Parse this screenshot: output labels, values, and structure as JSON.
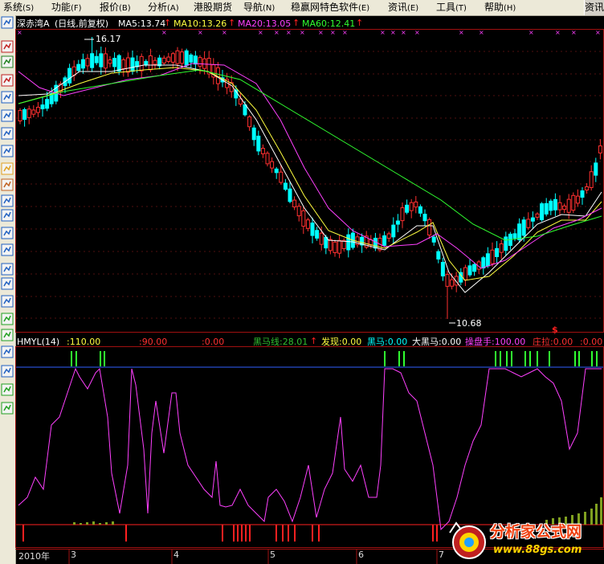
{
  "menu": {
    "items": [
      {
        "label": "系统",
        "hotkey": "(S)"
      },
      {
        "label": "功能",
        "hotkey": "(F)"
      },
      {
        "label": "报价",
        "hotkey": "(B)"
      },
      {
        "label": "分析",
        "hotkey": "(A)"
      },
      {
        "label": "港股期货",
        "hotkey": ""
      },
      {
        "label": "导航",
        "hotkey": "(N)"
      },
      {
        "label": "稳赢网特色软件",
        "hotkey": "(E)"
      },
      {
        "label": "资讯",
        "hotkey": "(E)"
      },
      {
        "label": "工具",
        "hotkey": "(T)"
      },
      {
        "label": "帮助",
        "hotkey": "(H)"
      }
    ],
    "right_label": "资讯"
  },
  "toolbar": {
    "icons": [
      "cursor-icon",
      "candlestick-icon",
      "line-chart-icon",
      "kline-icon",
      "news-icon",
      "table-icon",
      "list-icon",
      "f10-icon",
      "mail-icon",
      "users-icon",
      "compass-icon",
      "search-icon",
      "etf-icon",
      "wave-icon",
      "rsi-icon",
      "grid-icon",
      "layout-icon",
      "back-icon",
      "forward-icon",
      "play-icon",
      "move-icon",
      "up-icon",
      "down-icon"
    ]
  },
  "price_header": {
    "stock": "深赤湾A",
    "mode": "(日线,前复权)",
    "ma5": "MA5:13.74",
    "ma10": "MA10:13.26",
    "ma20": "MA20:13.05",
    "ma60": "MA60:12.41",
    "arrow": "↑"
  },
  "indicator_header": {
    "name": "HMYL(14)",
    "v110": ":110.00",
    "v90": ":90.00",
    "v0": ":0.00",
    "hmx": "黑马线:28.01",
    "arrow": "↑",
    "fx": "发现:0.00",
    "hm": "黑马:0.00",
    "dhm": "大黑马:0.00",
    "cps": "操盘手:100.00",
    "zl": "庄拉:0.00",
    "extra": ":0.00"
  },
  "annotations": {
    "high": "16.17",
    "low": "10.68",
    "sign": "$"
  },
  "x_axis": {
    "labels": [
      "2010年",
      "3",
      "4",
      "5",
      "6",
      "7"
    ]
  },
  "colors": {
    "up": "#ff3030",
    "down": "#00ffff",
    "ma5": "#ffffff",
    "ma10": "#ffff40",
    "ma20": "#ff40ff",
    "ma60": "#30ff30",
    "line_110": "#3060ff",
    "line_0": "#ff2020",
    "hmx_line": "#ff40ff"
  },
  "watermark": {
    "title": "分析家公式网",
    "url": "www.88gs.com"
  }
}
